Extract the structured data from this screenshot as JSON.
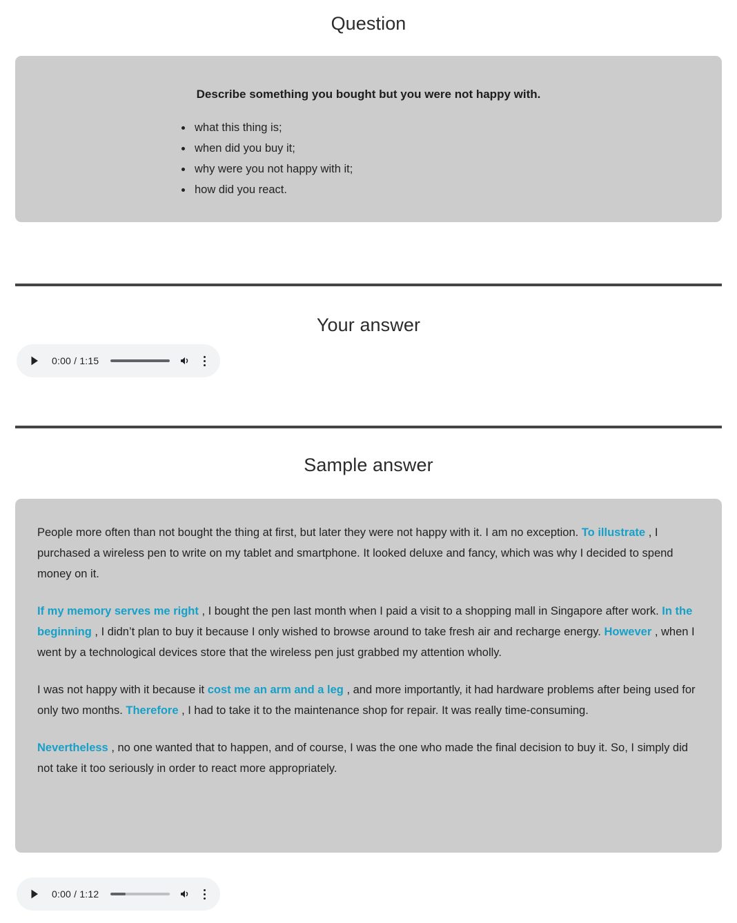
{
  "question": {
    "heading": "Question",
    "prompt": "Describe something you bought but you were not happy with.",
    "bullets": [
      "what this thing is;",
      "when did you buy it;",
      "why were you not happy with it;",
      "how did you react."
    ]
  },
  "your_answer": {
    "heading": "Your answer",
    "player": {
      "play_icon": "play-icon",
      "time": "0:00 / 1:15",
      "current_time": "0:00",
      "duration": "1:15",
      "buffered_percent": 100,
      "volume_icon": "volume-up-icon",
      "menu_icon": "more-vertical-icon"
    }
  },
  "sample_answer": {
    "heading": "Sample answer",
    "paragraphs": [
      [
        {
          "t": "People more often than not bought the thing at first, but later they were not happy with it. I am no exception. ",
          "hl": false
        },
        {
          "t": "To illustrate",
          "hl": true
        },
        {
          "t": " , I purchased a wireless pen to write on my tablet and smartphone. It looked deluxe and fancy, which was why I decided to spend money on it.",
          "hl": false
        }
      ],
      [
        {
          "t": "If my memory serves me right",
          "hl": true
        },
        {
          "t": " , I bought the pen last month when I paid a visit to a shopping mall in Singapore after work. ",
          "hl": false
        },
        {
          "t": "In the beginning",
          "hl": true
        },
        {
          "t": " , I didn’t plan to buy it because I only wished to browse around to take fresh air and recharge energy. ",
          "hl": false
        },
        {
          "t": "However",
          "hl": true
        },
        {
          "t": " , when I went by a technological devices store that the wireless pen just grabbed my attention wholly.",
          "hl": false
        }
      ],
      [
        {
          "t": "I was not happy with it because it ",
          "hl": false
        },
        {
          "t": "cost me an arm and a leg",
          "hl": true
        },
        {
          "t": " , and more importantly, it had hardware problems after being used for only two months. ",
          "hl": false
        },
        {
          "t": "Therefore",
          "hl": true
        },
        {
          "t": " , I had to take it to the maintenance shop for repair. It was really time-consuming.",
          "hl": false
        }
      ],
      [
        {
          "t": "Nevertheless",
          "hl": true
        },
        {
          "t": " , no one wanted that to happen, and of course, I was the one who made the final decision to buy it. So, I simply did not take it too seriously in order to react more appropriately.",
          "hl": false
        }
      ]
    ],
    "player": {
      "play_icon": "play-icon",
      "time": "0:00 / 1:12",
      "current_time": "0:00",
      "duration": "1:12",
      "buffered_percent": 25,
      "volume_icon": "volume-up-icon",
      "menu_icon": "more-vertical-icon"
    }
  },
  "colors": {
    "panel_bg": "#cccccc",
    "highlight": "#16a0c8",
    "divider": "#454545",
    "player_bg": "#f1f3f4",
    "text": "#222222"
  }
}
